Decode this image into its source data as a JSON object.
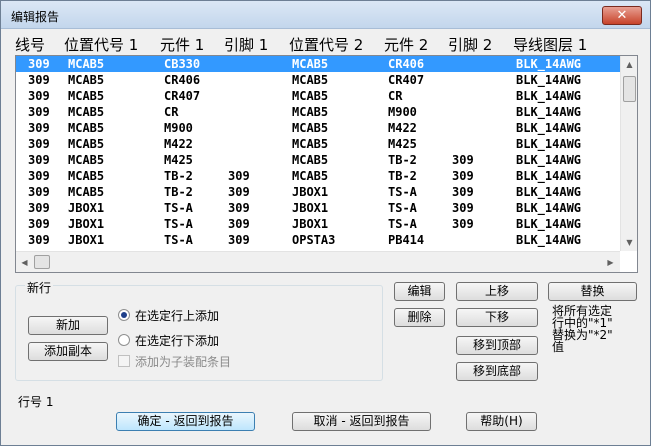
{
  "window": {
    "title": "编辑报告",
    "close_glyph": "✕"
  },
  "columns": [
    "线号",
    "位置代号 1",
    "元件 1",
    "引脚 1",
    "位置代号 2",
    "元件 2",
    "引脚 2",
    "导线图层 1"
  ],
  "rows": [
    [
      "309",
      "MCAB5",
      "CB330",
      "",
      "MCAB5",
      "CR406",
      "",
      "BLK_14AWG"
    ],
    [
      "309",
      "MCAB5",
      "CR406",
      "",
      "MCAB5",
      "CR407",
      "",
      "BLK_14AWG"
    ],
    [
      "309",
      "MCAB5",
      "CR407",
      "",
      "MCAB5",
      "CR",
      "",
      "BLK_14AWG"
    ],
    [
      "309",
      "MCAB5",
      "CR",
      "",
      "MCAB5",
      "M900",
      "",
      "BLK_14AWG"
    ],
    [
      "309",
      "MCAB5",
      "M900",
      "",
      "MCAB5",
      "M422",
      "",
      "BLK_14AWG"
    ],
    [
      "309",
      "MCAB5",
      "M422",
      "",
      "MCAB5",
      "M425",
      "",
      "BLK_14AWG"
    ],
    [
      "309",
      "MCAB5",
      "M425",
      "",
      "MCAB5",
      "TB-2",
      "309",
      "BLK_14AWG"
    ],
    [
      "309",
      "MCAB5",
      "TB-2",
      "309",
      "MCAB5",
      "TB-2",
      "309",
      "BLK_14AWG"
    ],
    [
      "309",
      "MCAB5",
      "TB-2",
      "309",
      "JBOX1",
      "TS-A",
      "309",
      "BLK_14AWG"
    ],
    [
      "309",
      "JBOX1",
      "TS-A",
      "309",
      "JBOX1",
      "TS-A",
      "309",
      "BLK_14AWG"
    ],
    [
      "309",
      "JBOX1",
      "TS-A",
      "309",
      "JBOX1",
      "TS-A",
      "309",
      "BLK_14AWG"
    ],
    [
      "309",
      "JBOX1",
      "TS-A",
      "309",
      "OPSTA3",
      "PB414",
      "",
      "BLK_14AWG"
    ]
  ],
  "selected_row": 0,
  "scroll": {
    "up": "▲",
    "down": "▼",
    "left": "◀",
    "right": "▶"
  },
  "new_row": {
    "group_label": "新行",
    "new_button": "新加",
    "add_copy_button": "添加副本",
    "insert_above": "在选定行上添加",
    "insert_below": "在选定行下添加",
    "add_as_child": "添加为子装配条目",
    "insert_above_selected": true
  },
  "edit_buttons": {
    "edit": "编辑",
    "delete": "删除",
    "move_up": "上移",
    "move_down": "下移",
    "move_top": "移到顶部",
    "move_bottom": "移到底部",
    "replace": "替换"
  },
  "replace_note": [
    "将所有选定",
    "行中的\"*1\"",
    "替换为\"*2\"",
    "值"
  ],
  "row_number_label": "行号 1",
  "footer": {
    "ok": "确定 - 返回到报告",
    "cancel": "取消 - 返回到报告",
    "help": "帮助(H)"
  }
}
